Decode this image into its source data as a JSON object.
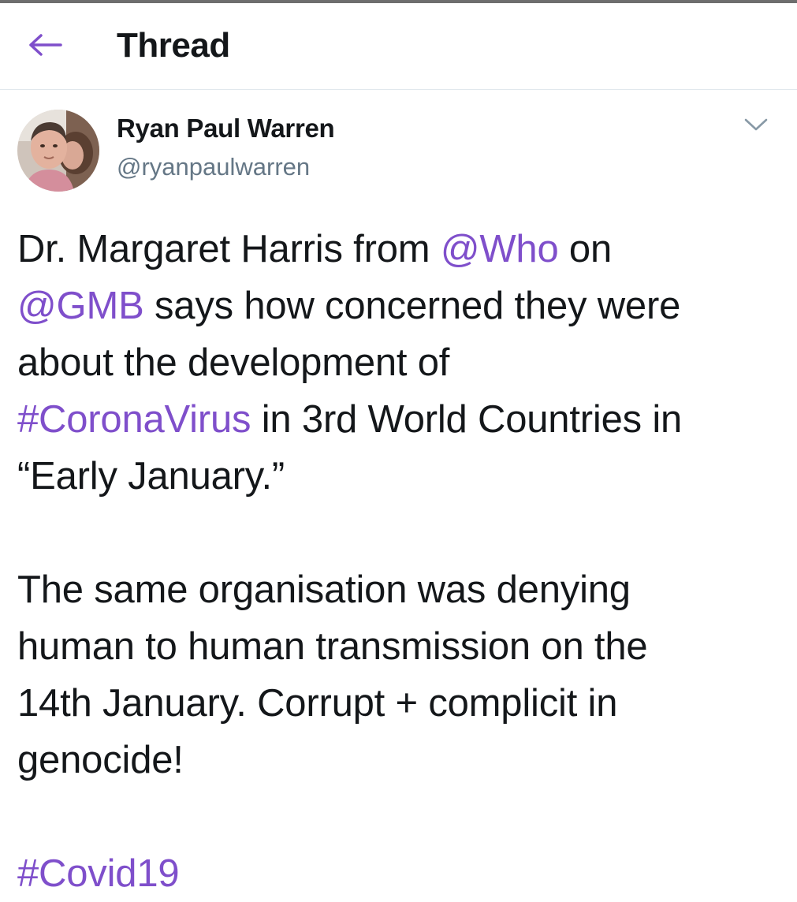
{
  "header": {
    "title": "Thread",
    "back_icon": "arrow-left-icon",
    "accent_color": "#7f4fcb"
  },
  "tweet": {
    "author_name": "Ryan Paul Warren",
    "author_handle": "@ryanpaulwarren",
    "menu_icon": "chevron-down-icon",
    "paragraph1": {
      "t1": "Dr. Margaret Harris from ",
      "mention_who": "@Who",
      "t2": " on",
      "mention_gmb": "@GMB",
      "t3": " says how concerned they were",
      "t4": "about the development of",
      "hashtag_corona": "#CoronaVirus",
      "t5": " in 3rd World Countries in",
      "t6": "“Early January.”"
    },
    "paragraph2": {
      "l1": "The same organisation was denying",
      "l2": "human to human transmission on the",
      "l3": "14th January. Corrupt + complicit in",
      "l4": "genocide!"
    },
    "hashtag_covid": "#Covid19"
  }
}
